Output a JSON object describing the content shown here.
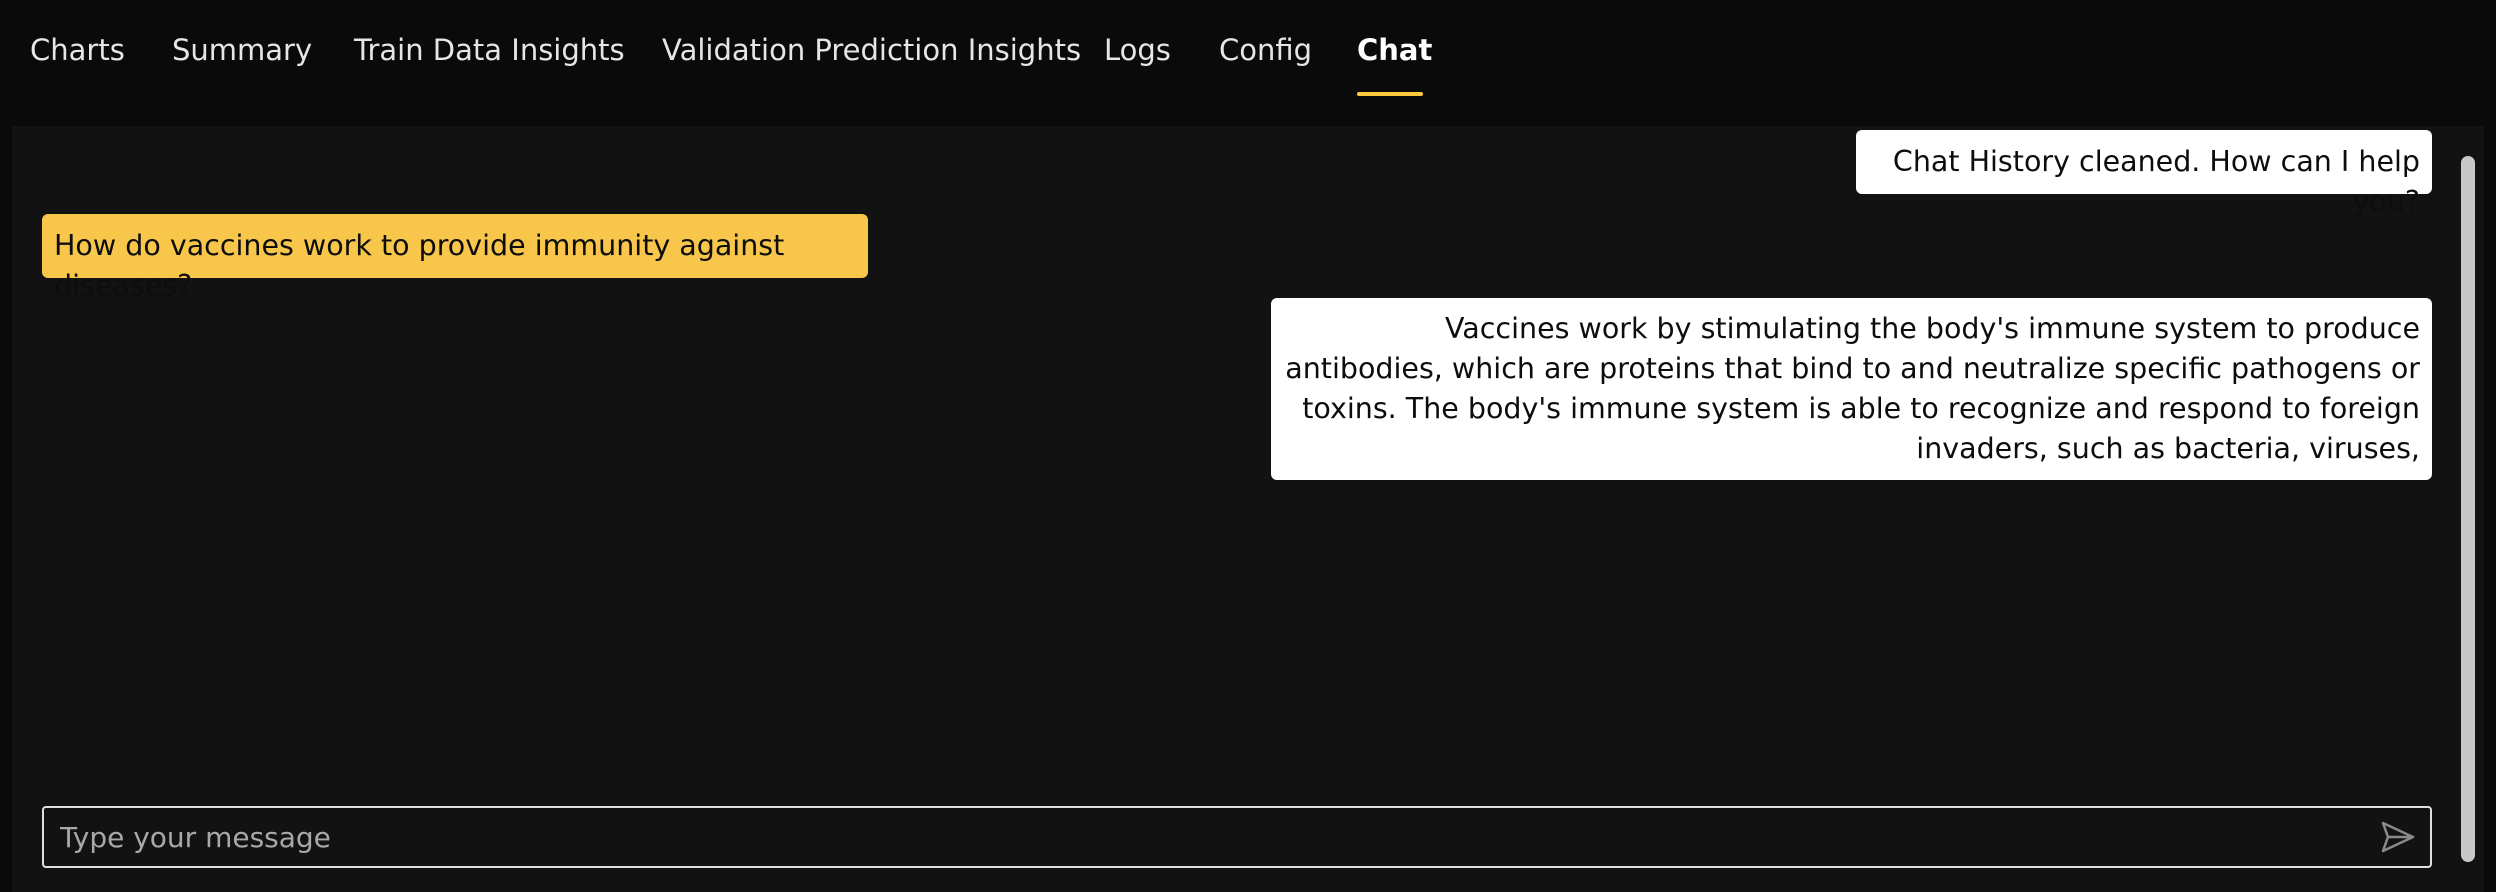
{
  "tabs": [
    {
      "label": "Charts"
    },
    {
      "label": "Summary"
    },
    {
      "label": "Train Data Insights"
    },
    {
      "label": "Validation Prediction Insights"
    },
    {
      "label": "Logs"
    },
    {
      "label": "Config"
    },
    {
      "label": "Chat",
      "active": true
    }
  ],
  "chat": {
    "messages": [
      {
        "role": "bot",
        "text": "Chat History cleaned. How can I help you?"
      },
      {
        "role": "user",
        "text": "How do vaccines work to provide immunity against diseases?"
      },
      {
        "role": "bot",
        "text": "Vaccines work by stimulating the body's immune system to produce antibodies, which are proteins that bind to and neutralize specific pathogens or toxins. The body's immune system is able to recognize and respond to foreign invaders, such as bacteria, viruses,"
      }
    ],
    "input": {
      "placeholder": "Type your message",
      "value": ""
    }
  },
  "icons": {
    "send": "send-arrow-icon"
  },
  "colors": {
    "accent": "#ffc83d",
    "user_bubble": "#f8c64a",
    "bot_bubble": "#ffffff",
    "background": "#0a0a0a",
    "panel": "#121212"
  }
}
